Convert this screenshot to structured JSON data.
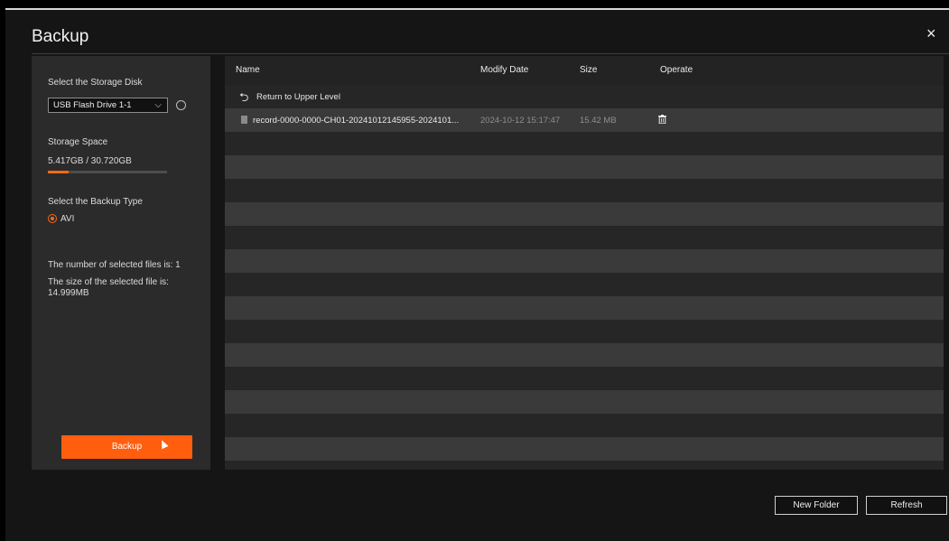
{
  "dialog": {
    "title": "Backup",
    "close_label": "×"
  },
  "left": {
    "storage_disk_label": "Select the Storage Disk",
    "storage_disk_value": "USB Flash Drive 1-1",
    "storage_space_label": "Storage Space",
    "storage_space_value": "5.417GB / 30.720GB",
    "storage_used_fraction": 0.176,
    "backup_type_label": "Select the Backup Type",
    "backup_type_option": "AVI",
    "selected_count_text": "The number of selected files is: 1",
    "selected_size_label": "The size of the selected file is:",
    "selected_size_value": "14.999MB",
    "backup_button": "Backup"
  },
  "table": {
    "headers": [
      "Name",
      "Modify Date",
      "Size",
      "Operate"
    ],
    "return_label": "Return to Upper Level",
    "files": [
      {
        "name": "record-0000-0000-CH01-20241012145955-2024101...",
        "modify_date": "2024-10-12 15:17:47",
        "size": "15.42 MB"
      }
    ]
  },
  "footer": {
    "new_folder": "New Folder",
    "refresh": "Refresh"
  },
  "colors": {
    "accent": "#ff5e0e",
    "panel": "#2b2b2b",
    "background": "#151515"
  },
  "icons": [
    "close-icon",
    "chevron-down-icon",
    "refresh-icon",
    "return-icon",
    "file-icon",
    "trash-icon",
    "mouse-cursor-icon"
  ]
}
